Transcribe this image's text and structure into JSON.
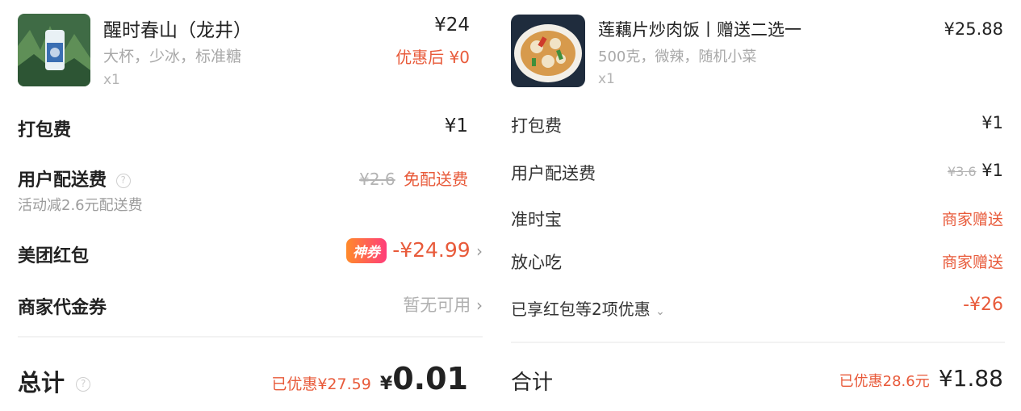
{
  "left": {
    "product": {
      "name": "醒时春山（龙井）",
      "spec": "大杯，少冰，标准糖",
      "qty": "x1",
      "price": "¥24",
      "discount_price": "优惠后 ¥0"
    },
    "packing_fee": {
      "label": "打包费",
      "value": "¥1"
    },
    "delivery_fee": {
      "label": "用户配送费",
      "original": "¥2.6",
      "value": "免配送费",
      "note": "活动减2.6元配送费"
    },
    "red_packet": {
      "label": "美团红包",
      "badge": "神券",
      "value": "-¥24.99"
    },
    "merchant_coupon": {
      "label": "商家代金券",
      "value": "暂无可用"
    },
    "total": {
      "label": "总计",
      "discount": "已优惠¥27.59",
      "currency": "¥",
      "amount": "0.01"
    }
  },
  "right": {
    "product": {
      "name": "莲藕片炒肉饭丨赠送二选一",
      "spec": "500克，微辣，随机小菜",
      "qty": "x1",
      "price": "¥25.88"
    },
    "packing_fee": {
      "label": "打包费",
      "value": "¥1"
    },
    "delivery_fee": {
      "label": "用户配送费",
      "original": "¥3.6",
      "value": "¥1"
    },
    "on_time": {
      "label": "准时宝",
      "value": "商家赠送"
    },
    "safe_eat": {
      "label": "放心吃",
      "value": "商家赠送"
    },
    "discounts": {
      "label": "已享红包等2项优惠",
      "value": "-¥26"
    },
    "total": {
      "label": "合计",
      "discount": "已优惠28.6元",
      "amount": "¥1.88"
    }
  },
  "colors": {
    "accent_red": "#e85a3a",
    "badge_start": "#ff8a2a",
    "badge_end": "#ff3d7a"
  },
  "icons": [
    "drink-thumbnail",
    "dish-thumbnail",
    "help-icon",
    "chevron-right-icon",
    "chevron-down-icon"
  ]
}
